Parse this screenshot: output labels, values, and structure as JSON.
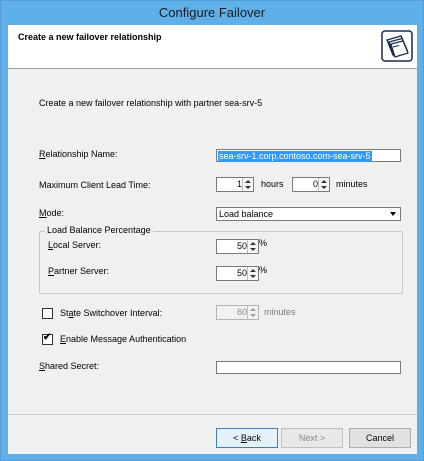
{
  "window": {
    "title": "Configure Failover"
  },
  "header": {
    "title": "Create a new failover relationship",
    "icon": "wizard-folders-icon"
  },
  "intro": {
    "text": "Create a new failover relationship with partner sea-srv-5"
  },
  "relationship_name": {
    "label_access": "R",
    "label_rest": "elationship Name:",
    "value": "sea-srv-1.corp.contoso.com-sea-srv-5"
  },
  "mclt": {
    "label": "Maximum Client Lead Time:",
    "hours_value": "1",
    "hours_unit": "hours",
    "minutes_value": "0",
    "minutes_unit": "minutes"
  },
  "mode": {
    "label_access": "M",
    "label_rest": "ode:",
    "value": "Load balance"
  },
  "load_balance": {
    "group_label": "Load Balance Percentage",
    "local_label_access": "L",
    "local_label_rest": "ocal Server:",
    "local_value": "50",
    "partner_label_access": "P",
    "partner_label_rest": "artner Server:",
    "partner_value": "50",
    "unit": "%"
  },
  "state_switchover": {
    "label_pre": "St",
    "label_access": "a",
    "label_rest": "te Switchover Interval:",
    "checked": false,
    "value": "60",
    "unit": "minutes"
  },
  "message_auth": {
    "label_access": "E",
    "label_rest": "nable Message Authentication",
    "checked": true,
    "check_glyph": "✔"
  },
  "shared_secret": {
    "label_access": "S",
    "label_rest": "hared Secret:",
    "value": ""
  },
  "buttons": {
    "back_pre": "< ",
    "back_access": "B",
    "back_rest": "ack",
    "next": "Next >",
    "cancel": "Cancel"
  }
}
